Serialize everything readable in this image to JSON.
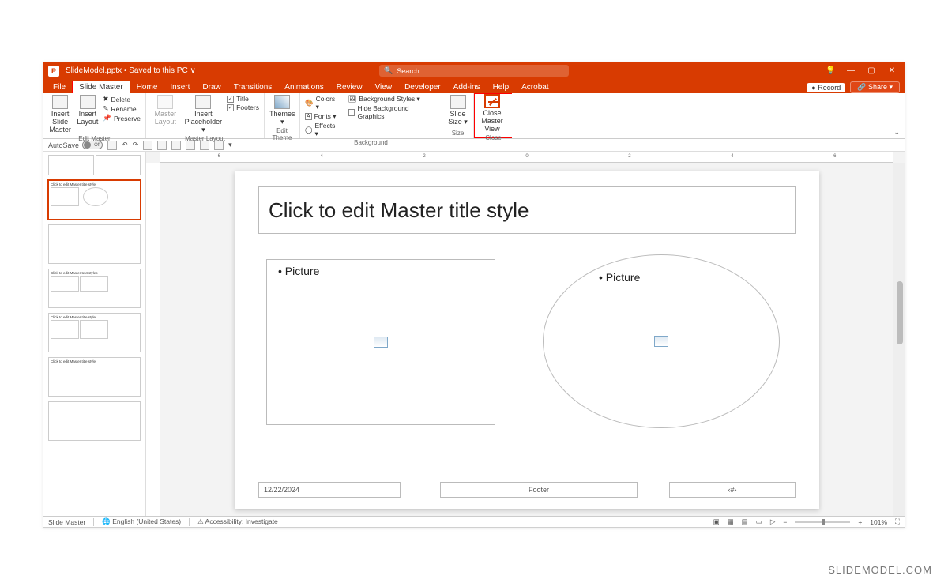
{
  "titlebar": {
    "app_icon": "P",
    "doc_name": "SlideModel.pptx",
    "save_status": "Saved to this PC",
    "search_placeholder": "Search"
  },
  "win_controls": {
    "bulb": "💡",
    "min": "—",
    "max": "▢",
    "close": "✕"
  },
  "tabs": [
    "File",
    "Slide Master",
    "Home",
    "Insert",
    "Draw",
    "Transitions",
    "Animations",
    "Review",
    "View",
    "Developer",
    "Add-ins",
    "Help",
    "Acrobat"
  ],
  "active_tab_index": 1,
  "header_buttons": {
    "record": "● Record",
    "share": "🔗 Share ▾"
  },
  "ribbon": {
    "edit_master": {
      "insert_slide_master": "Insert Slide\nMaster",
      "insert_layout": "Insert\nLayout",
      "delete": "Delete",
      "rename": "Rename",
      "preserve": "Preserve",
      "label": "Edit Master"
    },
    "master_layout": {
      "master_layout_btn": "Master\nLayout",
      "insert_placeholder": "Insert\nPlaceholder ▾",
      "title_chk": "Title",
      "footers_chk": "Footers",
      "label": "Master Layout"
    },
    "edit_theme": {
      "themes": "Themes\n▾",
      "label": "Edit Theme"
    },
    "background": {
      "colors": "Colors ▾",
      "fonts": "Fonts ▾",
      "effects": "Effects ▾",
      "bg_styles": "Background Styles ▾",
      "hide_bg": "Hide Background Graphics",
      "label": "Background"
    },
    "size": {
      "slide_size": "Slide\nSize ▾",
      "label": "Size"
    },
    "close": {
      "close_master": "Close\nMaster View",
      "label": "Close"
    }
  },
  "qat": {
    "autosave_label": "AutoSave",
    "autosave_state": "Off"
  },
  "slide": {
    "title_placeholder": "Click to edit Master title style",
    "picture_label_left": "• Picture",
    "picture_label_right": "• Picture",
    "footer_date": "12/22/2024",
    "footer_center": "Footer",
    "footer_num": "‹#›"
  },
  "ruler": {
    "marks": [
      "6",
      "",
      "4",
      "",
      "2",
      "",
      "0",
      "",
      "2",
      "",
      "4",
      "",
      "6"
    ]
  },
  "status": {
    "view": "Slide Master",
    "language": "English (United States)",
    "accessibility": "Accessibility: Investigate",
    "zoom": "101%"
  },
  "watermark": "SLIDEMODEL.COM"
}
